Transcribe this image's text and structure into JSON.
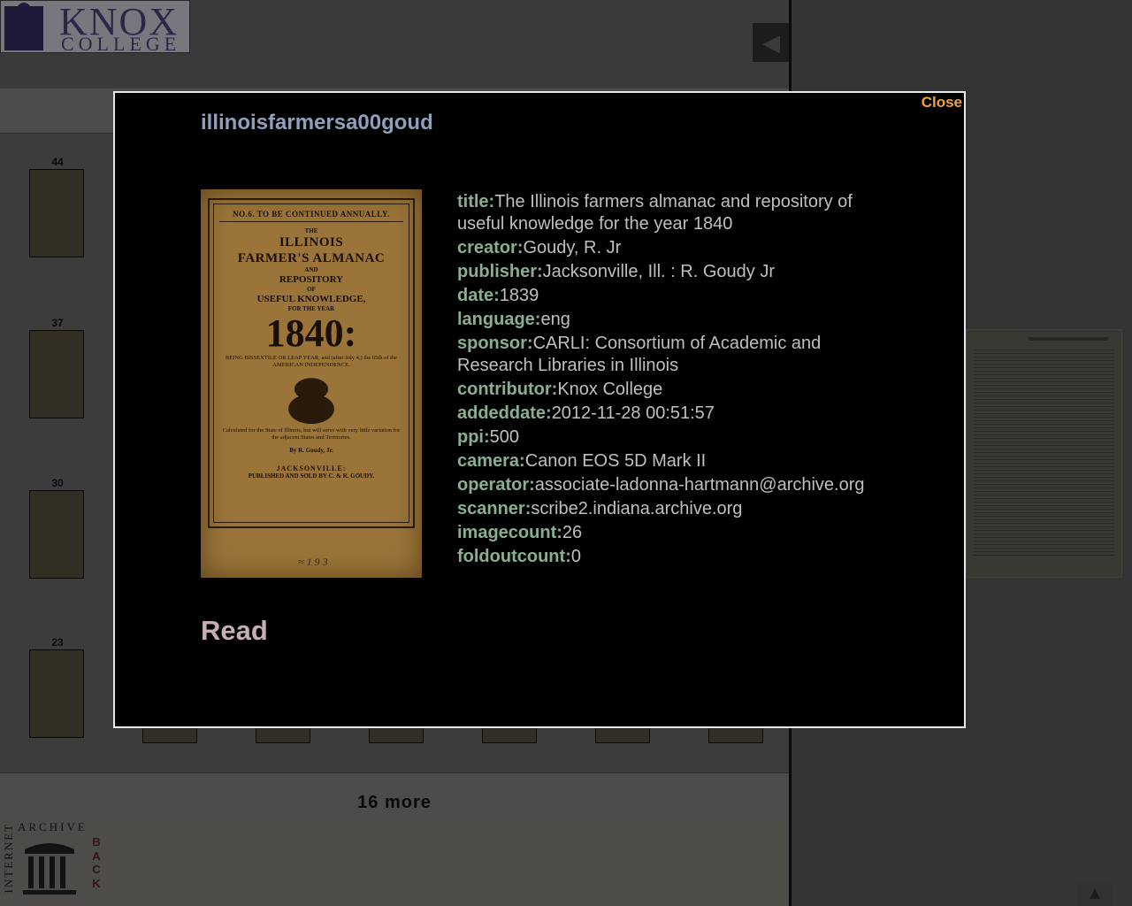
{
  "header": {
    "logo_text": "KNOX",
    "logo_subtext": "COLLEGE",
    "collapse_icon": "triangle-left-icon"
  },
  "grid": {
    "thumbnails": [
      {
        "number": "44"
      },
      {
        "number": "37"
      },
      {
        "number": "30"
      },
      {
        "number": "23"
      }
    ],
    "more_label": "16 more"
  },
  "footer": {
    "archive_top": "ARCHIVE",
    "archive_side": "INTERNET",
    "back_letters": [
      "B",
      "A",
      "C",
      "K"
    ]
  },
  "modal": {
    "close_label": "Close",
    "item_id": "illinoisfarmersa00goud",
    "cover": {
      "line_top": "NO.6. TO BE CONTINUED ANNUALLY.",
      "the": "THE",
      "title1": "ILLINOIS",
      "title2": "FARMER'S ALMANAC",
      "and": "AND",
      "title3": "REPOSITORY",
      "of": "OF",
      "title4": "USEFUL KNOWLEDGE,",
      "for_year": "FOR THE YEAR",
      "year": "1840:",
      "bissextile": "BEING BISSEXTILE OR LEAP YEAR, and (after July 4,) the 65th of the AMERICAN INDEPENDENCE.",
      "calculated": "Calculated for the State of Illinois, but will serve with very little variation for the adjacent States and Territories.",
      "by": "By R. Goudy, Jr.",
      "place": "JACKSONVILLE:",
      "published": "PUBLISHED AND SOLD BY C. & R. GOUDY."
    },
    "metadata": [
      {
        "key": "title:",
        "value": "The Illinois farmers almanac and repository of useful knowledge for the year 1840"
      },
      {
        "key": "creator:",
        "value": "Goudy, R. Jr"
      },
      {
        "key": "publisher:",
        "value": "Jacksonville, Ill. : R. Goudy Jr"
      },
      {
        "key": "date:",
        "value": "1839"
      },
      {
        "key": "language:",
        "value": "eng"
      },
      {
        "key": "sponsor:",
        "value": "CARLI: Consortium of Academic and Research Libraries in Illinois"
      },
      {
        "key": "contributor:",
        "value": "Knox College"
      },
      {
        "key": "addeddate:",
        "value": "2012-11-28 00:51:57"
      },
      {
        "key": "ppi:",
        "value": "500"
      },
      {
        "key": "camera:",
        "value": "Canon EOS 5D Mark II"
      },
      {
        "key": "operator:",
        "value": "associate-ladonna-hartmann@archive.org"
      },
      {
        "key": "scanner:",
        "value": "scribe2.indiana.archive.org"
      },
      {
        "key": "imagecount:",
        "value": "26"
      },
      {
        "key": "foldoutcount:",
        "value": "0"
      }
    ],
    "read_label": "Read"
  },
  "colors": {
    "close": "#f0a33a",
    "item_id": "#8da0bd",
    "meta_key": "#88b090",
    "meta_value": "#bfbfbf",
    "read": "#c7aeb1"
  }
}
